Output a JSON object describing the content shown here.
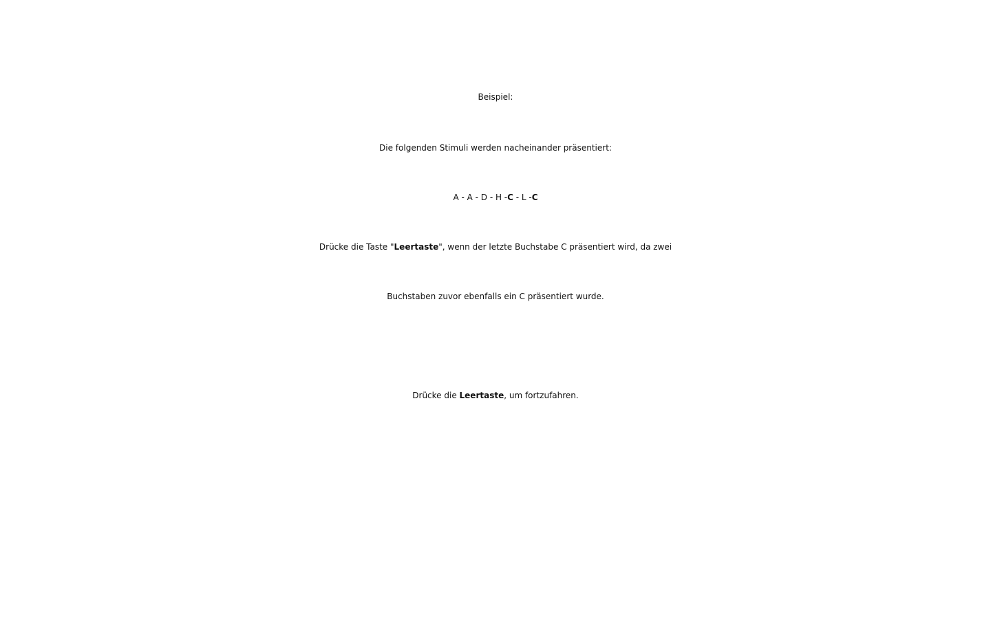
{
  "title": "Beispiel:",
  "intro": "Die folgenden Stimuli werden nacheinander präsentiert:",
  "sequence": {
    "part1": "A - A - D - H  -",
    "target1": "C",
    "part2": " - L  -",
    "target2": "C"
  },
  "explanation": {
    "line1_before": "Drücke die Taste \"",
    "line1_key": "Leertaste",
    "line1_after": "\", wenn der letzte Buchstabe C präsentiert wird, da zwei",
    "line2": "Buchstaben zuvor ebenfalls ein C präsentiert wurde."
  },
  "continue_prompt": {
    "before": "Drücke die ",
    "key": "Leertaste",
    "after": ", um fortzufahren."
  }
}
